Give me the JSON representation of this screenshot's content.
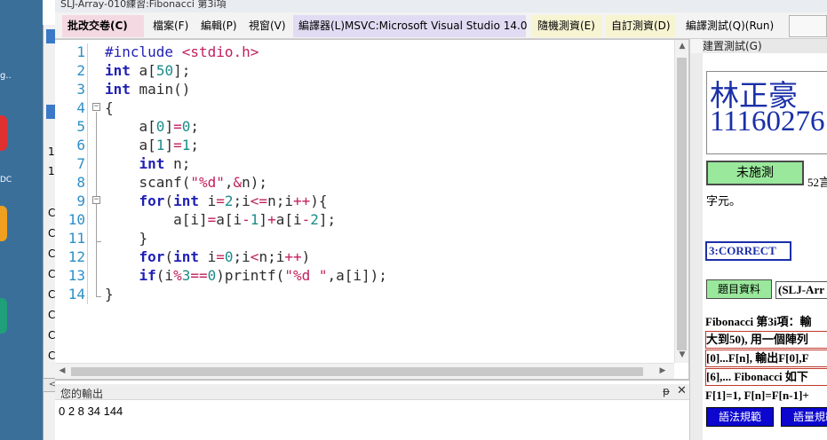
{
  "window": {
    "title": "SLJ-Array-010練習:Fibonacci 第3i項"
  },
  "menu": {
    "review": "批改交卷(C)",
    "file": "檔案(F)",
    "edit": "編輯(P)",
    "view": "視窗(V)",
    "compiler": "編譯器(L)MSVC:Microsoft Visual Studio 14.0",
    "random_test": "隨機測資(E)",
    "custom_test": "自訂測資(D)",
    "run_test": "編譯測試(Q)(Run)"
  },
  "background_window": {
    "lines": [
      "1",
      "1",
      "C",
      "C",
      "C",
      "C",
      "C",
      "C",
      "C",
      "C",
      "C"
    ],
    "scroll_arrow": "<"
  },
  "editor": {
    "line_numbers": [
      "1",
      "2",
      "3",
      "4",
      "5",
      "6",
      "7",
      "8",
      "9",
      "10",
      "11",
      "12",
      "13",
      "14"
    ],
    "code_lines": [
      "#include <stdio.h>",
      "int a[50];",
      "int main()",
      "{",
      "    a[0]=0;",
      "    a[1]=1;",
      "    int n;",
      "    scanf(\"%d\",&n);",
      "    for(int i=2;i<=n;i++){",
      "        a[i]=a[i-1]+a[i-2];",
      "    }",
      "    for(int i=0;i<n;i++)",
      "    if(i%3==0)printf(\"%d \",a[i]);",
      "}"
    ]
  },
  "output": {
    "title": "您的輸出",
    "text": "0 2 8 34 144",
    "pin": "ᵽ",
    "close": "✕"
  },
  "right_panel": {
    "tab": "建置測試(G)",
    "student_name": "林正豪",
    "student_id": "11160276",
    "status_button": "未施測",
    "byte_count": "52言",
    "byte_unit": "字元。",
    "result": "3:CORRECT",
    "problem_button": "題目資料",
    "problem_tag": "(SLJ-Arr",
    "description": [
      "Fibonacci 第3i項：輸",
      "大到50), 用一個陣列",
      "[0]...F[n], 輸出F[0],F",
      "[6],... Fibonacci 如下",
      "F[1]=1, F[n]=F[n-1]+"
    ],
    "syntax_button": "語法規範",
    "quota_button": "語量規範"
  }
}
